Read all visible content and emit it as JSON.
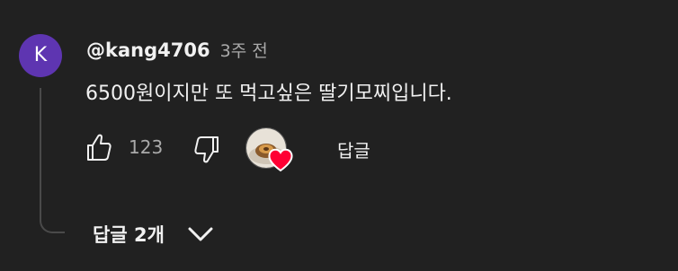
{
  "comment": {
    "avatar_letter": "K",
    "avatar_color": "#5e35b1",
    "author": "@kang4706",
    "time": "3주 전",
    "text": "6500원이지만 또 먹고싶은 딸기모찌입니다.",
    "like_count": "123",
    "reply_label": "답글",
    "replies_toggle_label": "답글 2개",
    "creator_heart": true,
    "heart_color": "#ff0033",
    "icons": {
      "like": "thumbs-up-icon",
      "dislike": "thumbs-down-icon",
      "expand": "chevron-down-icon",
      "heart": "heart-icon"
    }
  }
}
